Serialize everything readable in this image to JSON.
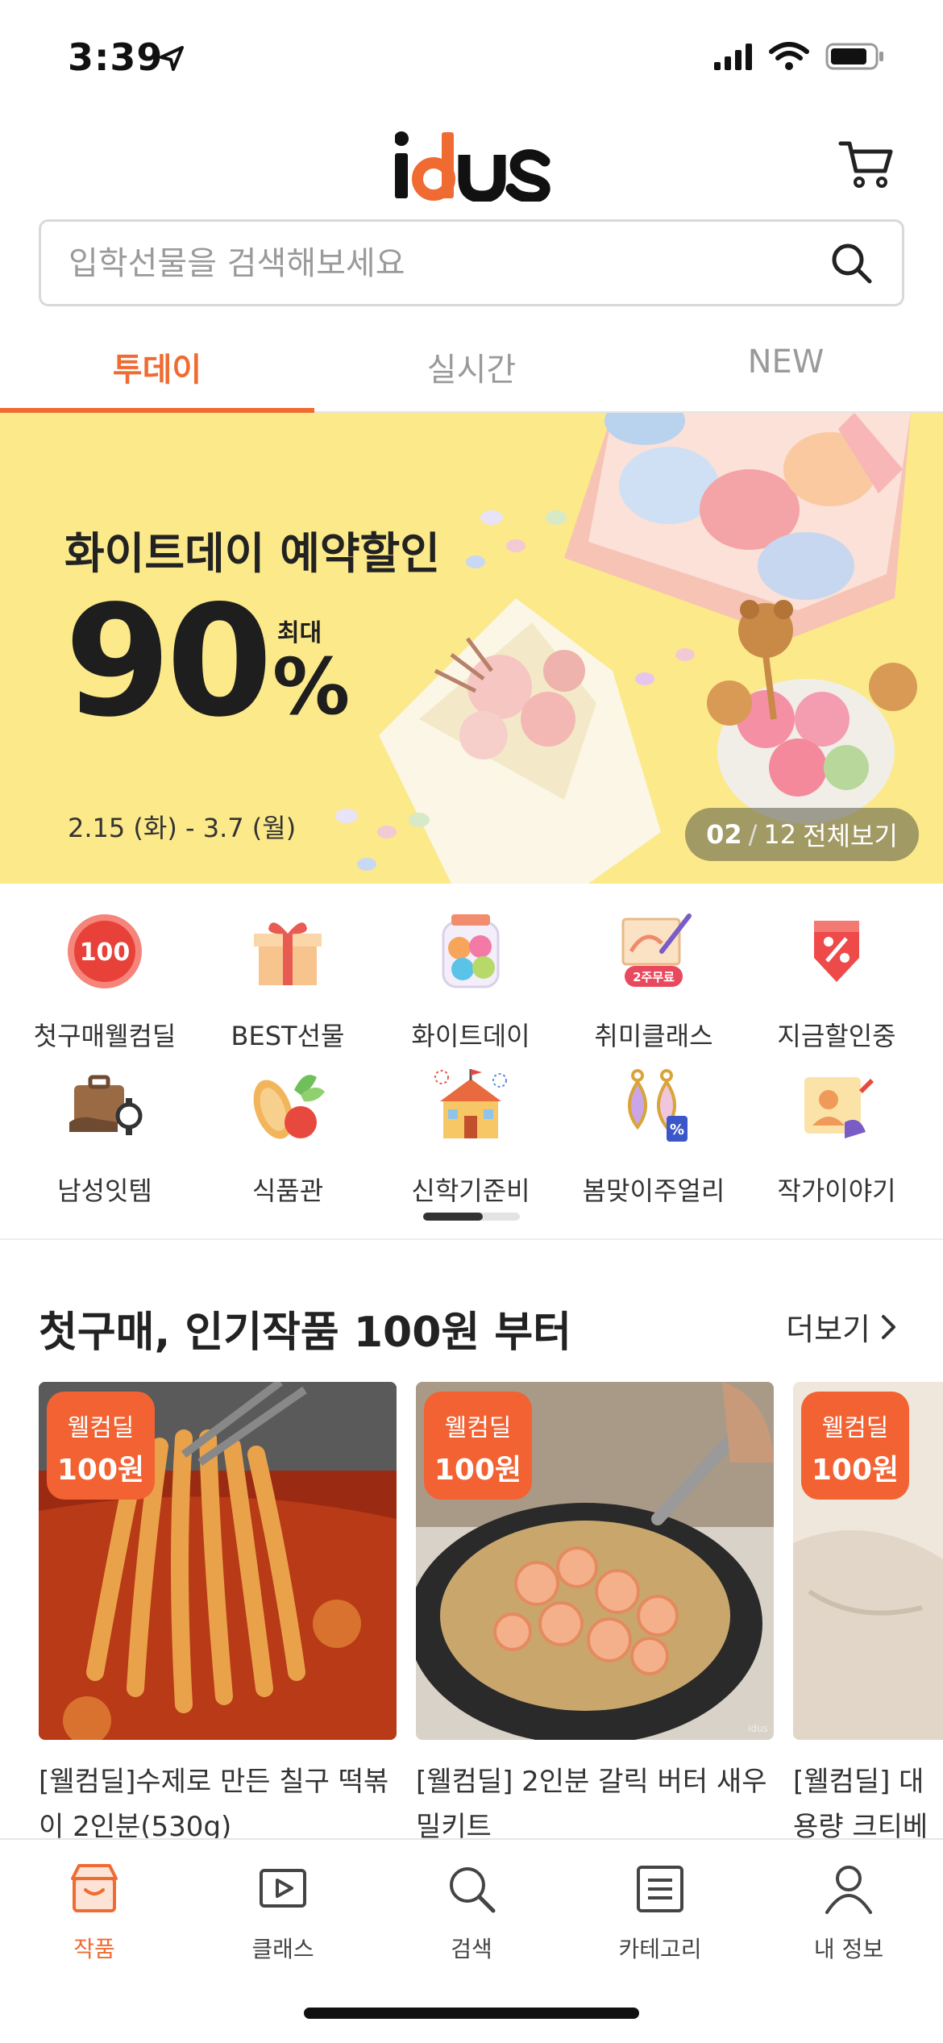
{
  "status": {
    "time": "3:39"
  },
  "search": {
    "placeholder": "입학선물을 검색해보세요"
  },
  "tabs": [
    {
      "label": "투데이",
      "active": true
    },
    {
      "label": "실시간",
      "active": false
    },
    {
      "label": "NEW",
      "active": false
    }
  ],
  "banner": {
    "title": "화이트데이 예약할인",
    "discount": "90",
    "percent": "%",
    "max_label": "최대",
    "date": "2.15 (화) - 3.7 (월)",
    "counter_current": "02",
    "counter_sep": "/",
    "counter_total": "12",
    "view_all": "전체보기"
  },
  "categories": [
    {
      "label": "첫구매웰컴딜",
      "icon": "100-badge-icon"
    },
    {
      "label": "BEST선물",
      "icon": "gift-box-icon"
    },
    {
      "label": "화이트데이",
      "icon": "candy-jar-icon"
    },
    {
      "label": "취미클래스",
      "icon": "palette-icon",
      "tag": "2주무료"
    },
    {
      "label": "지금할인중",
      "icon": "discount-tag-icon"
    },
    {
      "label": "남성잇템",
      "icon": "mens-items-icon"
    },
    {
      "label": "식품관",
      "icon": "food-icon"
    },
    {
      "label": "신학기준비",
      "icon": "school-icon"
    },
    {
      "label": "봄맞이주얼리",
      "icon": "earrings-icon"
    },
    {
      "label": "작가이야기",
      "icon": "artist-icon"
    }
  ],
  "category_badge_text": "100",
  "section": {
    "title": "첫구매, 인기작품 100원 부터",
    "more": "더보기"
  },
  "products": [
    {
      "badge_line1": "웰컴딜",
      "badge_line2": "100원",
      "title": "[웰컴딜]수제로 만든 칠구 떡볶이 2인분(530g)"
    },
    {
      "badge_line1": "웰컴딜",
      "badge_line2": "100원",
      "title": "[웰컴딜] 2인분 갈릭 버터 새우 밀키트"
    },
    {
      "badge_line1": "웰컴딜",
      "badge_line2": "100원",
      "title": "[웰컴딜] 대용량 크티베이스"
    }
  ],
  "product_watermark": "idus",
  "nav": [
    {
      "label": "작품",
      "icon": "store-icon",
      "active": true
    },
    {
      "label": "클래스",
      "icon": "play-icon",
      "active": false
    },
    {
      "label": "검색",
      "icon": "search-icon",
      "active": false
    },
    {
      "label": "카테고리",
      "icon": "list-icon",
      "active": false
    },
    {
      "label": "내 정보",
      "icon": "person-icon",
      "active": false
    }
  ],
  "colors": {
    "accent": "#f06b31",
    "banner_bg": "#fbe98a",
    "badge": "#f26233"
  }
}
